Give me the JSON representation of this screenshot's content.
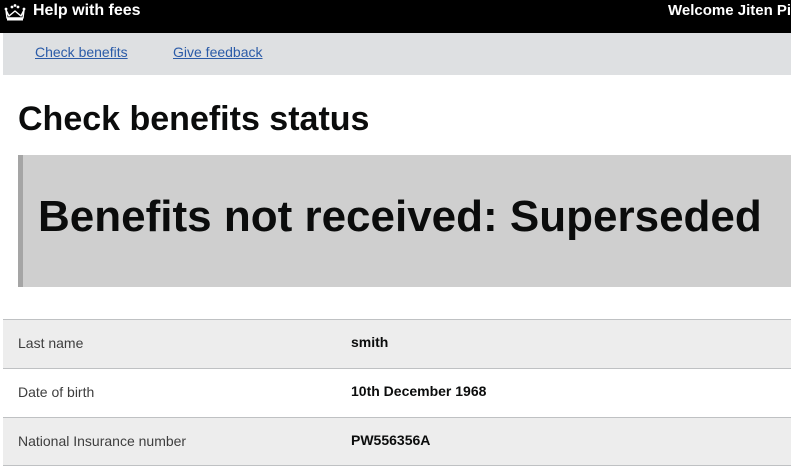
{
  "header": {
    "service_name": "Help with fees",
    "welcome_text": "Welcome Jiten Pit",
    "logo_icon": "crown-icon"
  },
  "subnav": {
    "items": [
      {
        "label": "Check benefits"
      },
      {
        "label": "Give feedback"
      }
    ]
  },
  "main": {
    "page_title": "Check benefits status",
    "status_message": "Benefits not received: Superseded",
    "details": [
      {
        "key": "Last name",
        "value": "smith"
      },
      {
        "key": "Date of birth",
        "value": "10th December 1968"
      },
      {
        "key": "National Insurance number",
        "value": "PW556356A"
      }
    ]
  },
  "colors": {
    "header_bg": "#000000",
    "subnav_bg": "#dee0e2",
    "link": "#2b5ba8",
    "panel_bg": "#cfcfcf",
    "panel_border": "#a5a5a5",
    "row_shade": "#ededed"
  }
}
